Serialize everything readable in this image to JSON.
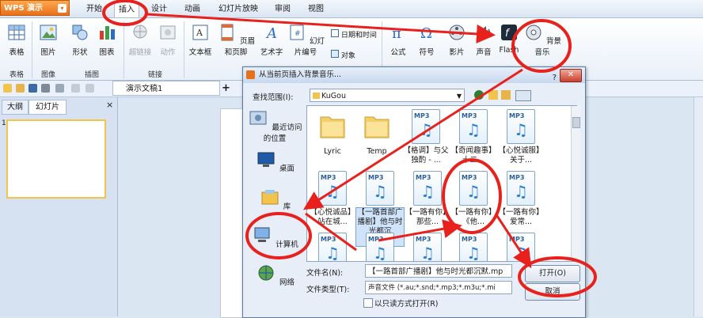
{
  "app": {
    "name": "WPS 演示"
  },
  "ribbon_tabs": [
    "开始",
    "插入",
    "设计",
    "动画",
    "幻灯片放映",
    "审阅",
    "视图"
  ],
  "ribbon": {
    "buttons": [
      "表格",
      "图片",
      "形状",
      "图表",
      "超链接",
      "动作",
      "文本框",
      "页眉和页脚",
      "艺术字",
      "幻灯片编号",
      "公式",
      "符号",
      "影片",
      "声音",
      "Flash",
      "背景音乐"
    ],
    "small_buttons": {
      "datetime": "日期和时间",
      "object": "对象"
    },
    "groups": [
      "表格",
      "图像",
      "插图",
      "链接"
    ]
  },
  "doc_tab": "演示文稿1",
  "left_panel": {
    "tabs": [
      "大纲",
      "幻灯片"
    ],
    "slide_number": "1"
  },
  "dialog": {
    "title": "从当前页插入背景音乐...",
    "look_in_label": "查找范围(I):",
    "look_in_value": "KuGou",
    "places": [
      "最近访问的位置",
      "桌面",
      "库",
      "计算机",
      "网络"
    ],
    "files": [
      {
        "type": "folder",
        "name": "Lyric"
      },
      {
        "type": "folder",
        "name": "Temp"
      },
      {
        "type": "mp3",
        "name": "【格调】与父独酌 - ..."
      },
      {
        "type": "mp3",
        "name": "【奇闻趣事】十二..."
      },
      {
        "type": "mp3",
        "name": "【心悦诚服】关于..."
      },
      {
        "type": "mp3",
        "name": "【心悦诚品】站在城..."
      },
      {
        "type": "mp3",
        "name": "【一路首部广播剧】他与时光都沉默.mp3"
      },
      {
        "type": "mp3",
        "name": "【一路有你】那些..."
      },
      {
        "type": "mp3",
        "name": "【一路有你】《他..."
      },
      {
        "type": "mp3",
        "name": "【一路有你】爱常..."
      }
    ],
    "file_name_label": "文件名(N):",
    "file_name_value": "【一路首部广播剧】他与时光都沉默.mp",
    "file_type_label": "文件类型(T):",
    "file_type_value": "声音文件 (*.au;*.snd;*.mp3;*.m3u;*.mi",
    "open_button": "打开(O)",
    "cancel_button": "取消",
    "readonly_label": "以只读方式打开(R)",
    "mp3_tag": "MP3"
  },
  "colors": {
    "annotation": "#e8211c",
    "accent": "#e8701a",
    "selection": "#cfe3fa"
  }
}
